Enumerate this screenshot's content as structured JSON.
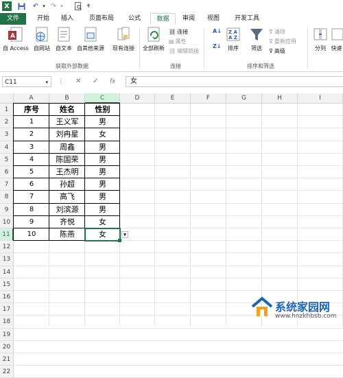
{
  "qat": {
    "logo": "X",
    "save_icon": "save-icon",
    "undo_icon": "undo-icon",
    "redo_icon": "redo-icon",
    "preview_icon": "print-preview-icon",
    "customize_icon": "customize-qat-icon"
  },
  "tabs": [
    "文件",
    "开始",
    "插入",
    "页面布局",
    "公式",
    "数据",
    "审阅",
    "视图",
    "开发工具"
  ],
  "active_tab": "数据",
  "ribbon": {
    "get_external": {
      "from_access": "自 Access",
      "from_web": "自网站",
      "from_text": "自文本",
      "from_other": "自其他来源",
      "existing": "现有连接",
      "group_label": "获取外部数据"
    },
    "connections": {
      "refresh_all": "全部刷新",
      "connections": "连接",
      "properties": "属性",
      "edit_links": "编辑链接",
      "group_label": "连接"
    },
    "sort_filter": {
      "sort": "排序",
      "filter": "筛选",
      "clear": "清除",
      "reapply": "重新应用",
      "advanced": "高级",
      "group_label": "排序和筛选"
    },
    "tools": {
      "split": "分列",
      "quick": "快速"
    }
  },
  "formula_bar": {
    "name_box": "C11",
    "fx": "fx",
    "value": "女"
  },
  "columns": [
    "A",
    "B",
    "C",
    "D",
    "E",
    "F",
    "G",
    "H",
    "I"
  ],
  "rows": [
    "1",
    "2",
    "3",
    "4",
    "5",
    "6",
    "7",
    "8",
    "9",
    "10",
    "11",
    "12",
    "13",
    "14",
    "15",
    "16",
    "17",
    "18",
    "19",
    "20",
    "21",
    "22"
  ],
  "table": {
    "headers": [
      "序号",
      "姓名",
      "性别"
    ],
    "data": [
      [
        "1",
        "王义军",
        "男"
      ],
      [
        "2",
        "刘冉星",
        "女"
      ],
      [
        "3",
        "周鑫",
        "男"
      ],
      [
        "4",
        "陈国荣",
        "男"
      ],
      [
        "5",
        "王杰明",
        "男"
      ],
      [
        "6",
        "孙超",
        "男"
      ],
      [
        "7",
        "高飞",
        "男"
      ],
      [
        "8",
        "刘滨源",
        "男"
      ],
      [
        "9",
        "齐悦",
        "女"
      ],
      [
        "10",
        "陈燕",
        "女"
      ]
    ]
  },
  "watermark": {
    "site": "系统家园网",
    "url": "www.hnzkhbsb.com"
  }
}
